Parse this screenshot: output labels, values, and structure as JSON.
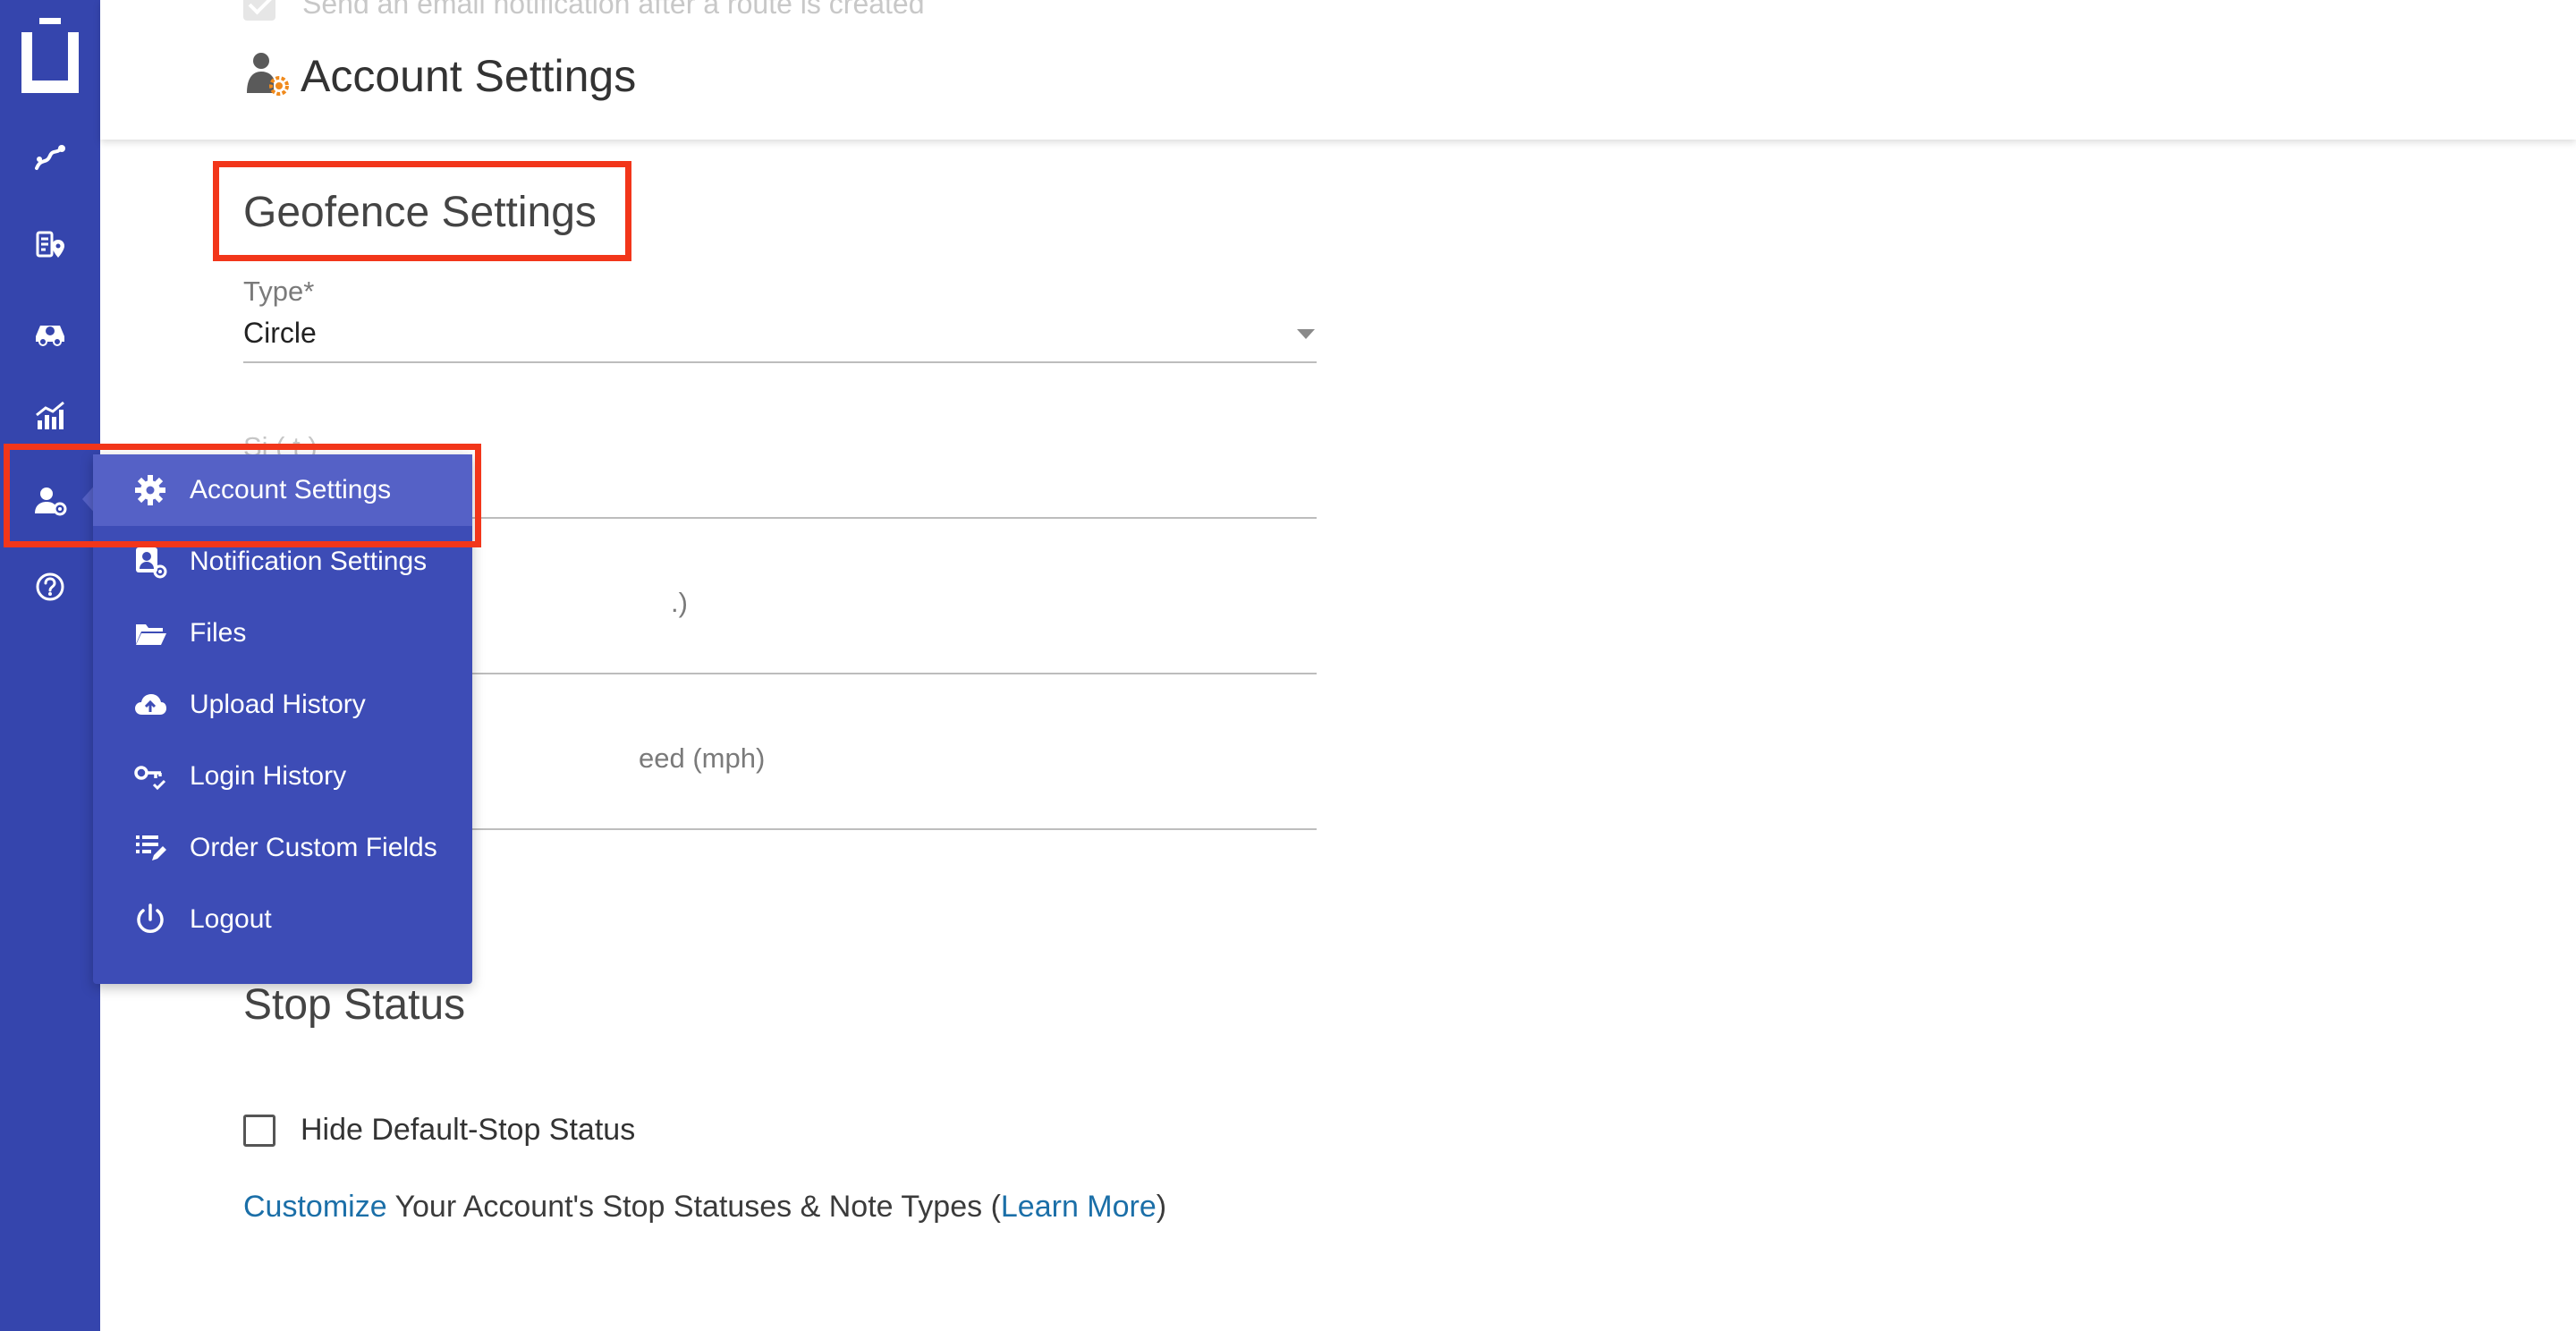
{
  "header": {
    "ghost_checkbox_label": "Send an email notification after a route is created",
    "title": "Account Settings"
  },
  "geofence": {
    "section_title": "Geofence Settings",
    "type_label": "Type*",
    "type_value": "Circle",
    "size_label_partial": "Si (  t  )",
    "field3_label_partial": ".)",
    "speed_label_partial": "eed (mph)"
  },
  "stop_status": {
    "section_title": "Stop Status",
    "hide_default_label": "Hide Default-Stop Status",
    "customize_link": "Customize",
    "middle_text": " Your Account's Stop Statuses & Note Types (",
    "learn_more_link": "Learn More",
    "closing_paren": ")"
  },
  "menu": {
    "items": [
      {
        "label": "Account Settings",
        "icon": "gear-icon"
      },
      {
        "label": "Notification Settings",
        "icon": "user-gear-icon"
      },
      {
        "label": "Files",
        "icon": "folder-open-icon"
      },
      {
        "label": "Upload History",
        "icon": "cloud-upload-icon"
      },
      {
        "label": "Login History",
        "icon": "key-check-icon"
      },
      {
        "label": "Order Custom Fields",
        "icon": "list-edit-icon"
      },
      {
        "label": "Logout",
        "icon": "power-icon"
      }
    ]
  },
  "rail": {
    "icons": [
      "logo-icon",
      "routes-icon",
      "route-map-icon",
      "drivers-icon",
      "analytics-icon",
      "account-icon",
      "help-icon"
    ]
  },
  "colors": {
    "rail": "#3545ad",
    "menu": "#3d4cb6",
    "menu_active": "#5561c6",
    "highlight": "#f2361a",
    "link": "#1b6fa8"
  }
}
